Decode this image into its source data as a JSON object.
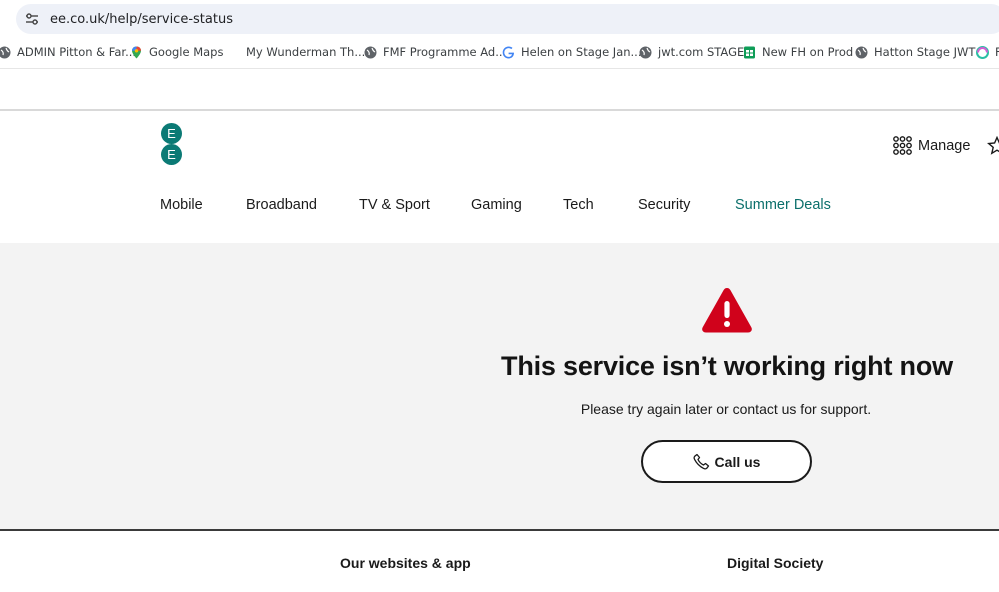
{
  "browser": {
    "url": "ee.co.uk/help/service-status",
    "bookmarks": [
      {
        "label": "ADMIN Pitton & Far...",
        "icon": "globe-icon"
      },
      {
        "label": "Google Maps",
        "icon": "maps-pin-icon"
      },
      {
        "label": "My Wunderman Th...",
        "icon": "blank-icon"
      },
      {
        "label": "FMF Programme Ad...",
        "icon": "globe-icon"
      },
      {
        "label": "Helen on Stage Jan...",
        "icon": "google-g-icon"
      },
      {
        "label": "jwt.com STAGE",
        "icon": "globe-icon"
      },
      {
        "label": "New FH on Prod",
        "icon": "sheets-icon"
      },
      {
        "label": "Hatton  Stage JWT",
        "icon": "globe-icon"
      },
      {
        "label": "F",
        "icon": "edge-icon"
      }
    ]
  },
  "header": {
    "logo_text": "EE",
    "manage_label": "Manage",
    "nav": [
      {
        "label": "Mobile"
      },
      {
        "label": "Broadband"
      },
      {
        "label": "TV & Sport"
      },
      {
        "label": "Gaming"
      },
      {
        "label": "Tech"
      },
      {
        "label": "Security"
      },
      {
        "label": "Summer Deals"
      }
    ]
  },
  "main": {
    "icon": "warning-triangle-icon",
    "headline": "This service isn’t working right now",
    "subtext": "Please try again later or contact us for support.",
    "call_button": "Call us"
  },
  "footer": {
    "col1_heading": "Our websites & app",
    "col2_heading": "Digital Society"
  },
  "colors": {
    "brand_teal": "#0b6f6b",
    "warning_red": "#d0021b",
    "main_bg": "#f3f3f3"
  }
}
